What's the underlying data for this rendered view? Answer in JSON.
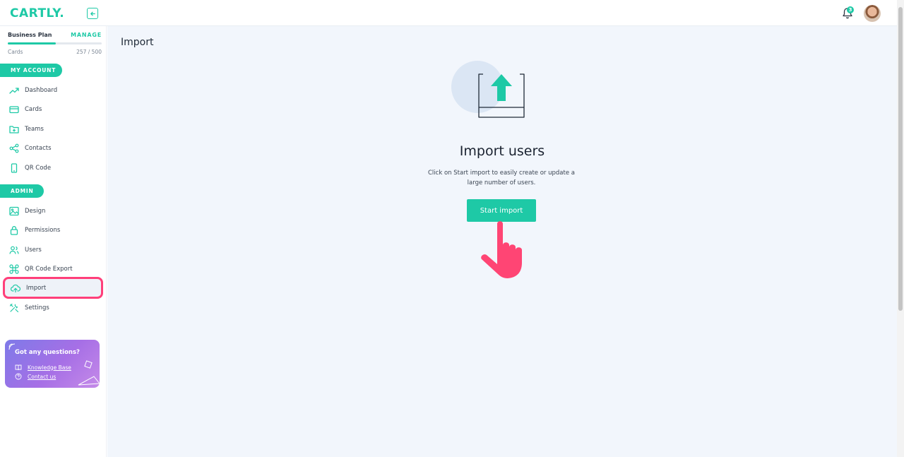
{
  "topbar": {
    "logo_text": "CARTLY.",
    "notifications_count": "3"
  },
  "sidebar": {
    "plan": {
      "name": "Business Plan",
      "manage_label": "MANAGE",
      "usage_fraction": 0.514
    },
    "cards_usage": {
      "label": "Cards",
      "value": "257 / 500"
    },
    "my_account_label": "MY ACCOUNT",
    "admin_label": "ADMIN",
    "my_account_items": [
      {
        "label": "Dashboard",
        "icon": "trend-icon"
      },
      {
        "label": "Cards",
        "icon": "card-icon"
      },
      {
        "label": "Teams",
        "icon": "folder-plus-icon"
      },
      {
        "label": "Contacts",
        "icon": "share-icon"
      },
      {
        "label": "QR Code",
        "icon": "phone-icon"
      }
    ],
    "admin_items": [
      {
        "label": "Design",
        "icon": "image-icon"
      },
      {
        "label": "Permissions",
        "icon": "lock-icon"
      },
      {
        "label": "Users",
        "icon": "users-icon"
      },
      {
        "label": "QR Code Export",
        "icon": "command-icon"
      },
      {
        "label": "Import",
        "icon": "cloud-upload-icon",
        "active": true
      },
      {
        "label": "Settings",
        "icon": "tools-icon"
      }
    ],
    "help": {
      "title": "Got any questions?",
      "knowledge_base": "Knowledge Base",
      "contact_us": "Contact us"
    }
  },
  "main": {
    "page_title": "Import",
    "heading": "Import users",
    "description": "Click on Start import to easily create or update a large number of users.",
    "start_button": "Start import"
  },
  "colors": {
    "accent": "#1ec9a6",
    "highlight": "#ff3f7a",
    "main_bg": "#f2f6fc"
  }
}
